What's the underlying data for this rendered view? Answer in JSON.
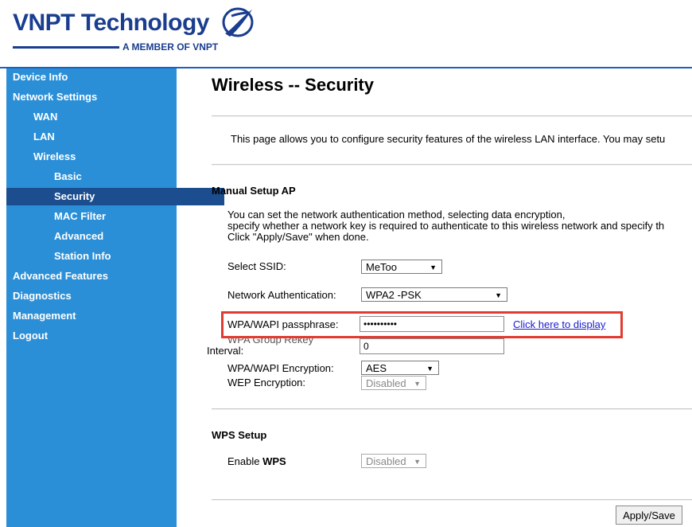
{
  "brand": {
    "name": "VNPT Technology",
    "tagline": "A MEMBER OF VNPT",
    "color": "#1a3d8f"
  },
  "sidebar": {
    "bg_color": "#2b8fd8",
    "active_color": "#1b4d8f",
    "items": [
      {
        "label": "Device Info",
        "level": 0
      },
      {
        "label": "Network Settings",
        "level": 0
      },
      {
        "label": "WAN",
        "level": 1
      },
      {
        "label": "LAN",
        "level": 1
      },
      {
        "label": "Wireless",
        "level": 1
      },
      {
        "label": "Basic",
        "level": 2
      },
      {
        "label": "Security",
        "level": 2,
        "active": true
      },
      {
        "label": "MAC Filter",
        "level": 2
      },
      {
        "label": "Advanced",
        "level": 2
      },
      {
        "label": "Station Info",
        "level": 2
      },
      {
        "label": "Advanced Features",
        "level": 0
      },
      {
        "label": "Diagnostics",
        "level": 0
      },
      {
        "label": "Management",
        "level": 0
      },
      {
        "label": "Logout",
        "level": 0
      }
    ]
  },
  "main": {
    "title": "Wireless -- Security",
    "description": "This page allows you to configure security features of the wireless LAN interface. You may setu",
    "manual": {
      "heading": "Manual Setup AP",
      "para_line1": "You can set the network authentication method, selecting data encryption,",
      "para_line2": "specify whether a network key is required to authenticate to this wireless network and specify th",
      "para_line3": "Click \"Apply/Save\" when done.",
      "ssid_label": "Select SSID:",
      "ssid_value": "MeToo",
      "auth_label": "Network Authentication:",
      "auth_value": "WPA2 -PSK",
      "pass_label": "WPA/WAPI passphrase:",
      "pass_value": "••••••••••",
      "display_link": "Click here to display",
      "rekey_label_line1": "WPA Group Rekey",
      "rekey_label_line2": "Interval:",
      "rekey_value": "0",
      "enc_label": "WPA/WAPI Encryption:",
      "enc_value": "AES",
      "wep_label": "WEP Encryption:",
      "wep_value": "Disabled"
    },
    "wps": {
      "heading": "WPS Setup",
      "enable_label_prefix": "Enable ",
      "enable_label_bold": "WPS",
      "enable_value": "Disabled"
    },
    "apply_label": "Apply/Save"
  },
  "icons": {
    "select_arrow": "dropdown-arrow-icon",
    "logo_mark": "vnpt-logo-icon"
  }
}
